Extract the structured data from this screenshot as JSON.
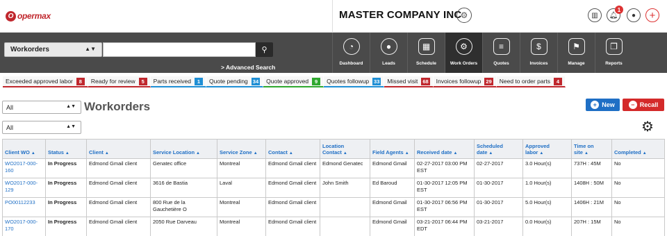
{
  "brand": {
    "logo_mark": "O",
    "logo_text": "opermax"
  },
  "header": {
    "company": "MASTER COMPANY INC",
    "notification_count": "1"
  },
  "search": {
    "module": "Workorders",
    "value": "",
    "placeholder": "",
    "advanced_label": "> Advanced Search"
  },
  "nav": [
    {
      "label": "Dashboard",
      "icon": "dashboard-icon",
      "glyph": "◔"
    },
    {
      "label": "Leads",
      "icon": "leads-icon",
      "glyph": "●"
    },
    {
      "label": "Schedule",
      "icon": "schedule-icon",
      "glyph": "▦"
    },
    {
      "label": "Work Orders",
      "icon": "work-orders-icon",
      "glyph": "⚙"
    },
    {
      "label": "Quotes",
      "icon": "quotes-icon",
      "glyph": "≡"
    },
    {
      "label": "Invoices",
      "icon": "invoices-icon",
      "glyph": "$"
    },
    {
      "label": "Manage",
      "icon": "manage-icon",
      "glyph": "⚑"
    },
    {
      "label": "Reports",
      "icon": "reports-icon",
      "glyph": "❐"
    }
  ],
  "filters": [
    {
      "label": "Exceeded approved labor",
      "count": "8",
      "color": "#c0272d",
      "accent": "darkred"
    },
    {
      "label": "Ready for review",
      "count": "5",
      "color": "#c0272d",
      "accent": "darkred"
    },
    {
      "label": "Parts received",
      "count": "1",
      "color": "#1f8fd5",
      "accent": "blue"
    },
    {
      "label": "Quote pending",
      "count": "34",
      "color": "#1f8fd5",
      "accent": "blue"
    },
    {
      "label": "Quote approved",
      "count": "9",
      "color": "#2fa82f",
      "accent": "green"
    },
    {
      "label": "Quotes followup",
      "count": "33",
      "color": "#1f8fd5",
      "accent": "blue"
    },
    {
      "label": "Missed visit",
      "count": "68",
      "color": "#c0272d",
      "accent": "darkred"
    },
    {
      "label": "Invoices followup",
      "count": "29",
      "color": "#c0272d",
      "accent": "darkred"
    },
    {
      "label": "Need to order parts",
      "count": "4",
      "color": "#c0272d",
      "accent": "darkred"
    }
  ],
  "list": {
    "select_1": "All",
    "select_2": "All",
    "title": "Workorders",
    "new_label": "New",
    "recall_label": "Recall"
  },
  "table": {
    "sort_glyph": "▲",
    "columns": [
      "Client WO",
      "Status",
      "Client",
      "Service Location",
      "Service Zone",
      "Contact",
      "Location Contact",
      "Field Agents",
      "Received date",
      "Scheduled date",
      "Approved labor",
      "Time on site",
      "Completed"
    ],
    "rows": [
      [
        "WO2017-000-160",
        "In Progress",
        "Edmond Gmail client",
        "Genatec office",
        "Montreal",
        "Edmond Gmail client",
        "Edmond Genatec",
        "Edmond Gmail",
        "02-27-2017 03:00 PM EST",
        "02-27-2017",
        "3.0 Hour(s)",
        "737H : 45M",
        "No"
      ],
      [
        "WO2017-000-129",
        "In Progress",
        "Edmond Gmail client",
        "3616 de Bastia",
        "Laval",
        "Edmond Gmail client",
        "John Smith",
        "Ed Baroud",
        "01-30-2017 12:05 PM EST",
        "01-30-2017",
        "1.0 Hour(s)",
        "1408H : 50M",
        "No"
      ],
      [
        "PO00112233",
        "In Progress",
        "Edmond Gmail client",
        "800 Rue de la Gauchetière O",
        "Montreal",
        "Edmond Gmail client",
        "",
        "Edmond Gmail",
        "01-30-2017 06:56 PM EST",
        "01-30-2017",
        "5.0 Hour(s)",
        "1406H : 21M",
        "No"
      ],
      [
        "WO2017-000-170",
        "In Progress",
        "Edmond Gmail client",
        "2050 Rue Darveau",
        "Montreal",
        "Edmond Gmail client",
        "",
        "Edmond Gmail",
        "03-21-2017 06:44 PM EDT",
        "03-21-2017",
        "0.0 Hour(s)",
        "207H : 15M",
        "No"
      ]
    ]
  }
}
